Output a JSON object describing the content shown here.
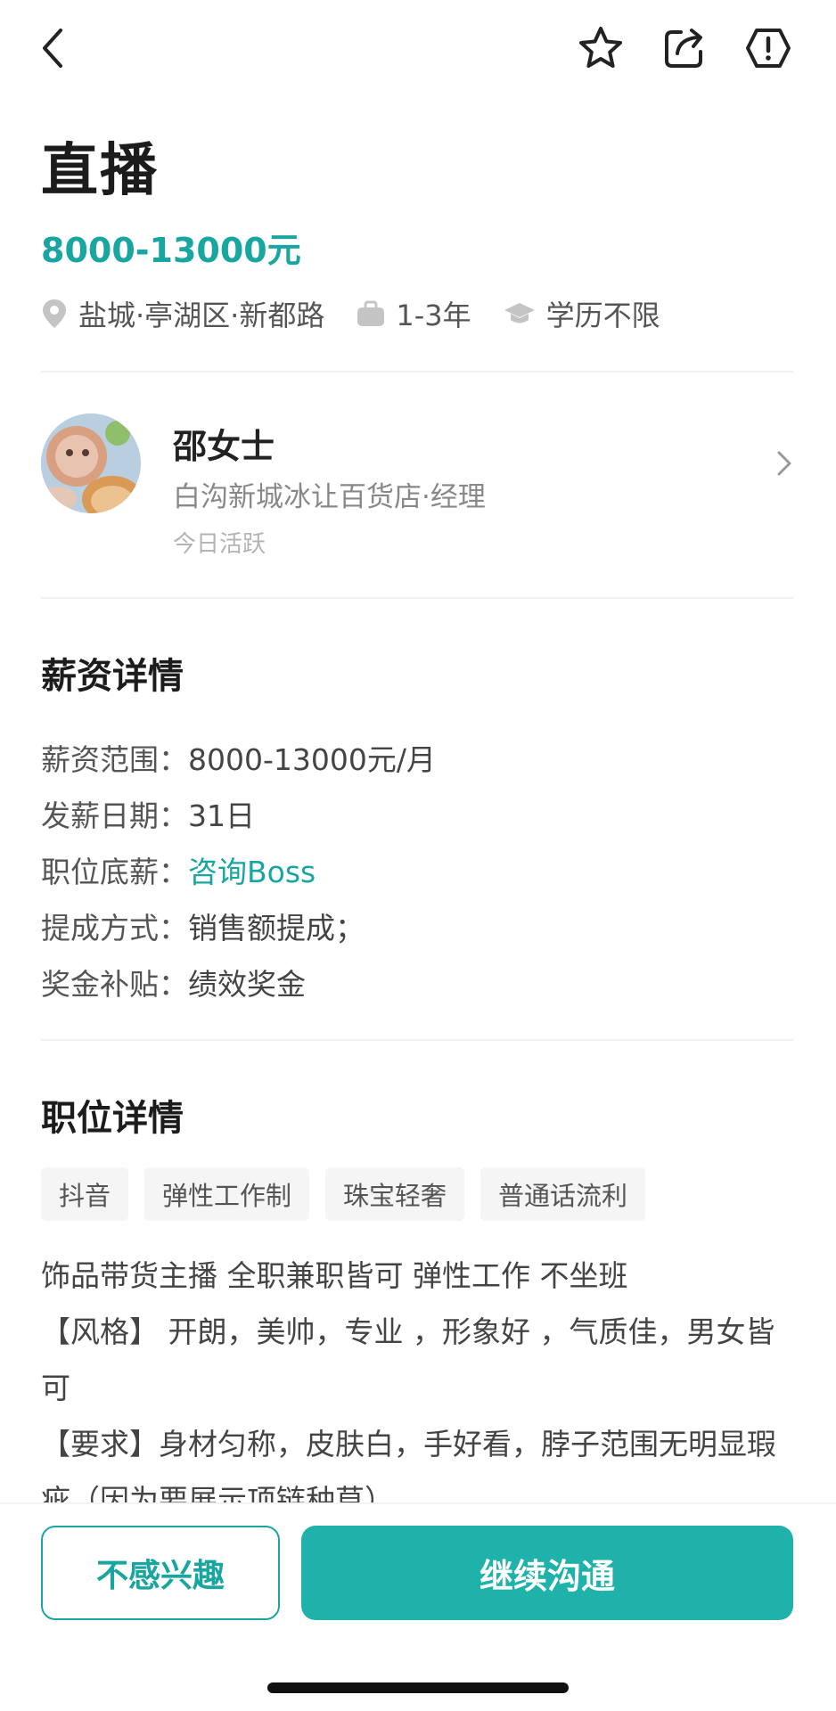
{
  "header": {
    "icons": [
      "back-arrow-icon",
      "star-icon",
      "share-icon",
      "report-warning-icon"
    ]
  },
  "job": {
    "title": "直播",
    "salary": "8000-13000元",
    "location": "盐城·亭湖区·新都路",
    "experience": "1-3年",
    "education": "学历不限"
  },
  "recruiter": {
    "name": "邵女士",
    "company": "白沟新城冰让百货店·经理",
    "active": "今日活跃"
  },
  "salary_section": {
    "title": "薪资详情",
    "rows": [
      {
        "label": "薪资范围：",
        "value": "8000-13000元/月"
      },
      {
        "label": "发薪日期：",
        "value": "31日"
      },
      {
        "label": "职位底薪：",
        "value": "咨询Boss"
      },
      {
        "label": "提成方式：",
        "value": "销售额提成；"
      },
      {
        "label": "奖金补贴：",
        "value": "绩效奖金"
      }
    ]
  },
  "position_section": {
    "title": "职位详情",
    "tags": [
      "抖音",
      "弹性工作制",
      "珠宝轻奢",
      "普通话流利"
    ],
    "description": [
      "饰品带货主播 全职兼职皆可 弹性工作 不坐班",
      "【风格】 开朗，美帅，专业 ，形象好 ，气质佳，男女皆可",
      "【要求】身材匀称，皮肤白，手好看，脖子范围无明显瑕疵（因为要展示项链种草）"
    ]
  },
  "actions": {
    "decline_label": "不感兴趣",
    "continue_label": "继续沟通"
  },
  "colors": {
    "accent": "#1aa6a0",
    "button_fill": "#1eb2ab"
  }
}
